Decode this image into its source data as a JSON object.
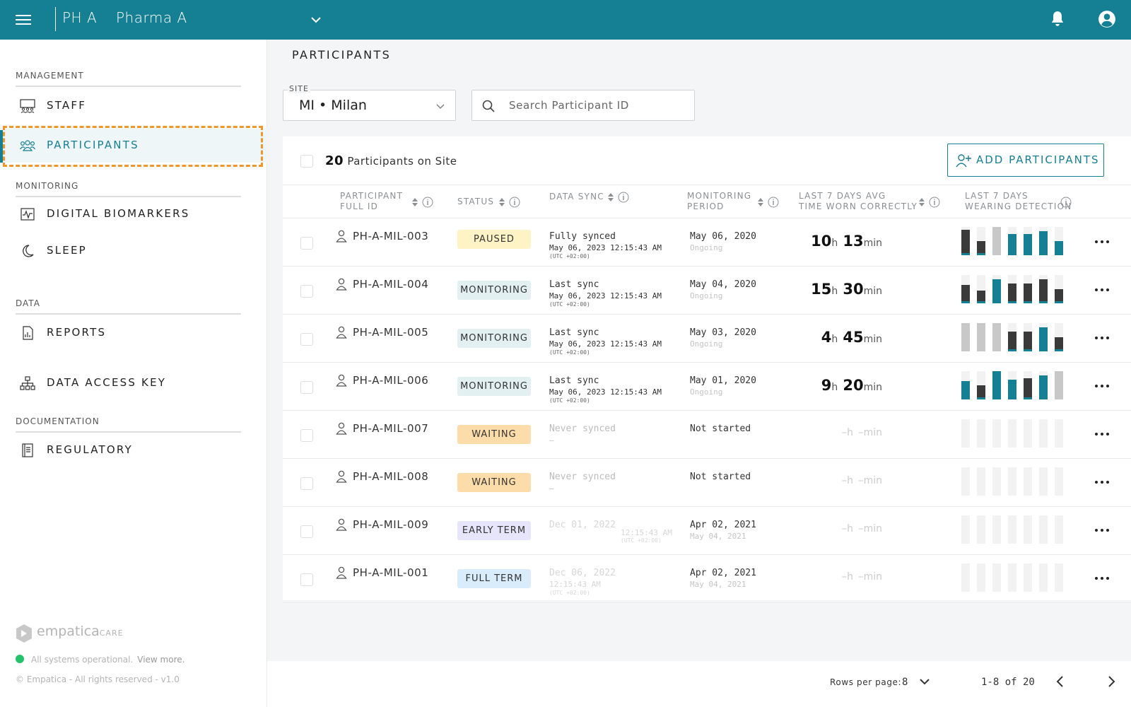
{
  "colors": {
    "brand": "#157f93",
    "highlight": "#f0962a",
    "status_ok": "#22c36a",
    "bar_teal": "#157f93",
    "bar_dark": "#3a3a3a",
    "bar_gray": "#c8c8c8"
  },
  "topbar": {
    "menu_icon": "hamburger-menu-icon",
    "org_code": "PH A",
    "org_name": "Pharma A",
    "dropdown_icon": "chevron-down-icon",
    "notifications_icon": "bell-icon",
    "account_icon": "user-circle-icon"
  },
  "sidebar": {
    "sections": [
      {
        "label": "MANAGEMENT",
        "items": [
          {
            "label": "STAFF",
            "icon": "staff-icon"
          },
          {
            "label": "PARTICIPANTS",
            "icon": "participants-icon",
            "active": true
          }
        ]
      },
      {
        "label": "MONITORING",
        "items": [
          {
            "label": "DIGITAL BIOMARKERS",
            "icon": "biomarkers-chart-icon"
          },
          {
            "label": "SLEEP",
            "icon": "moon-icon"
          }
        ]
      },
      {
        "label": "DATA",
        "items": [
          {
            "label": "REPORTS",
            "icon": "report-document-icon"
          },
          {
            "label": "DATA ACCESS KEY",
            "icon": "hierarchy-icon"
          }
        ]
      },
      {
        "label": "DOCUMENTATION",
        "items": [
          {
            "label": "REGULATORY",
            "icon": "regulatory-book-icon"
          }
        ]
      }
    ],
    "footer": {
      "brand": "empatica",
      "brand_suffix": "CARE",
      "status_text": "All systems operational.",
      "status_link": "View more.",
      "copyright": "© Empatica - All rights reserved - v1.0"
    }
  },
  "main": {
    "title": "PARTICIPANTS",
    "site": {
      "label": "SITE",
      "value": "MI • Milan"
    },
    "search": {
      "placeholder": "Search Participant ID"
    },
    "count": {
      "number": "20",
      "text": "Participants on Site"
    },
    "add_button": "ADD PARTICIPANTS",
    "columns": {
      "participant": [
        "PARTICIPANT",
        "FULL ID"
      ],
      "status": [
        "STATUS"
      ],
      "data_sync": [
        "DATA SYNC"
      ],
      "monitoring": [
        "MONITORING",
        "PERIOD"
      ],
      "worn": [
        "LAST 7 DAYS AVG",
        "TIME WORN CORRECTLY"
      ],
      "wearing": [
        "LAST 7 DAYS",
        "WEARING DETECTION"
      ]
    },
    "rows": [
      {
        "id": "PH-A-MIL-003",
        "status": "PAUSED",
        "status_color": "#fdf3c4",
        "sync_line1": "Fully synced",
        "sync_line2": "May 06, 2023 12:15:43 AM",
        "sync_line3": "(UTC +02:00)",
        "period_line1": "May 06, 2020",
        "period_line2": "Ongoing",
        "hours": "10",
        "minutes": "13",
        "wearing": [
          {
            "level": 0.9,
            "type": "dark"
          },
          {
            "level": 0.5,
            "type": "dark"
          },
          {
            "level": 1.0,
            "type": "gray"
          },
          {
            "level": 0.75,
            "type": "teal"
          },
          {
            "level": 0.75,
            "type": "teal"
          },
          {
            "level": 0.85,
            "type": "teal"
          },
          {
            "level": 0.5,
            "type": "teal"
          }
        ]
      },
      {
        "id": "PH-A-MIL-004",
        "status": "MONITORING",
        "status_color": "#e3f0f1",
        "sync_line1": "Last sync",
        "sync_line2": "May 06, 2023 12:15:43 AM",
        "sync_line3": "(UTC +02:00)",
        "period_line1": "May 04, 2020",
        "period_line2": "Ongoing",
        "hours": "15",
        "minutes": "30",
        "wearing": [
          {
            "level": 0.65,
            "type": "dark"
          },
          {
            "level": 0.45,
            "type": "dark"
          },
          {
            "level": 0.85,
            "type": "teal"
          },
          {
            "level": 0.7,
            "type": "dark"
          },
          {
            "level": 0.7,
            "type": "dark"
          },
          {
            "level": 0.85,
            "type": "dark"
          },
          {
            "level": 0.5,
            "type": "dark"
          }
        ]
      },
      {
        "id": "PH-A-MIL-005",
        "status": "MONITORING",
        "status_color": "#e3f0f1",
        "sync_line1": "Last sync",
        "sync_line2": "May 06, 2023 12:15:43 AM",
        "sync_line3": "(UTC +02:00)",
        "period_line1": "May 03, 2020",
        "period_line2": "Ongoing",
        "hours": "4",
        "minutes": "45",
        "wearing": [
          {
            "level": 1.0,
            "type": "gray"
          },
          {
            "level": 1.0,
            "type": "gray"
          },
          {
            "level": 1.0,
            "type": "gray"
          },
          {
            "level": 0.7,
            "type": "dark"
          },
          {
            "level": 0.7,
            "type": "dark"
          },
          {
            "level": 0.85,
            "type": "teal"
          },
          {
            "level": 0.5,
            "type": "dark"
          }
        ]
      },
      {
        "id": "PH-A-MIL-006",
        "status": "MONITORING",
        "status_color": "#e3f0f1",
        "sync_line1": "Last sync",
        "sync_line2": "May 06, 2023 12:15:43 AM",
        "sync_line3": "(UTC +02:00)",
        "period_line1": "May 01, 2020",
        "period_line2": "Ongoing",
        "hours": "9",
        "minutes": "20",
        "wearing": [
          {
            "level": 0.65,
            "type": "teal"
          },
          {
            "level": 0.5,
            "type": "dark"
          },
          {
            "level": 1.0,
            "type": "teal"
          },
          {
            "level": 0.7,
            "type": "teal"
          },
          {
            "level": 0.75,
            "type": "dark"
          },
          {
            "level": 0.85,
            "type": "teal"
          },
          {
            "level": 1.0,
            "type": "gray"
          }
        ]
      },
      {
        "id": "PH-A-MIL-007",
        "status": "WAITING",
        "status_color": "#fcdca8",
        "sync_line1": "Never synced",
        "sync_line2": "–",
        "sync_line3": "",
        "period_line1": "Not started",
        "period_line2": "",
        "hours": "–",
        "minutes": "–",
        "wearing": []
      },
      {
        "id": "PH-A-MIL-008",
        "status": "WAITING",
        "status_color": "#fcdca8",
        "sync_line1": "Never synced",
        "sync_line2": "–",
        "sync_line3": "",
        "period_line1": "Not started",
        "period_line2": "",
        "hours": "–",
        "minutes": "–",
        "wearing": []
      },
      {
        "id": "PH-A-MIL-009",
        "status": "EARLY TERM",
        "status_color": "#e6e5fb",
        "sync_line1": "Dec 01, 2022",
        "sync_line2": "12:15:43 AM",
        "sync_line3": "(UTC +02:00)",
        "period_line1": "Apr 02, 2021",
        "period_line2": "May 04, 2021",
        "hours": "–",
        "minutes": "–",
        "wearing": []
      },
      {
        "id": "PH-A-MIL-001",
        "status": "FULL TERM",
        "status_color": "#d8ecfb",
        "sync_line1": "Dec 06, 2022",
        "sync_line2": "12:15:43 AM",
        "sync_line3": "(UTC +02:00)",
        "period_line1": "Apr 02, 2021",
        "period_line2": "May 04, 2021",
        "hours": "–",
        "minutes": "–",
        "wearing": []
      }
    ],
    "units": {
      "hours": "h",
      "minutes": "min"
    }
  },
  "pagination": {
    "rows_label": "Rows per page:",
    "rows_value": "8",
    "range": "1-8 of 20"
  }
}
